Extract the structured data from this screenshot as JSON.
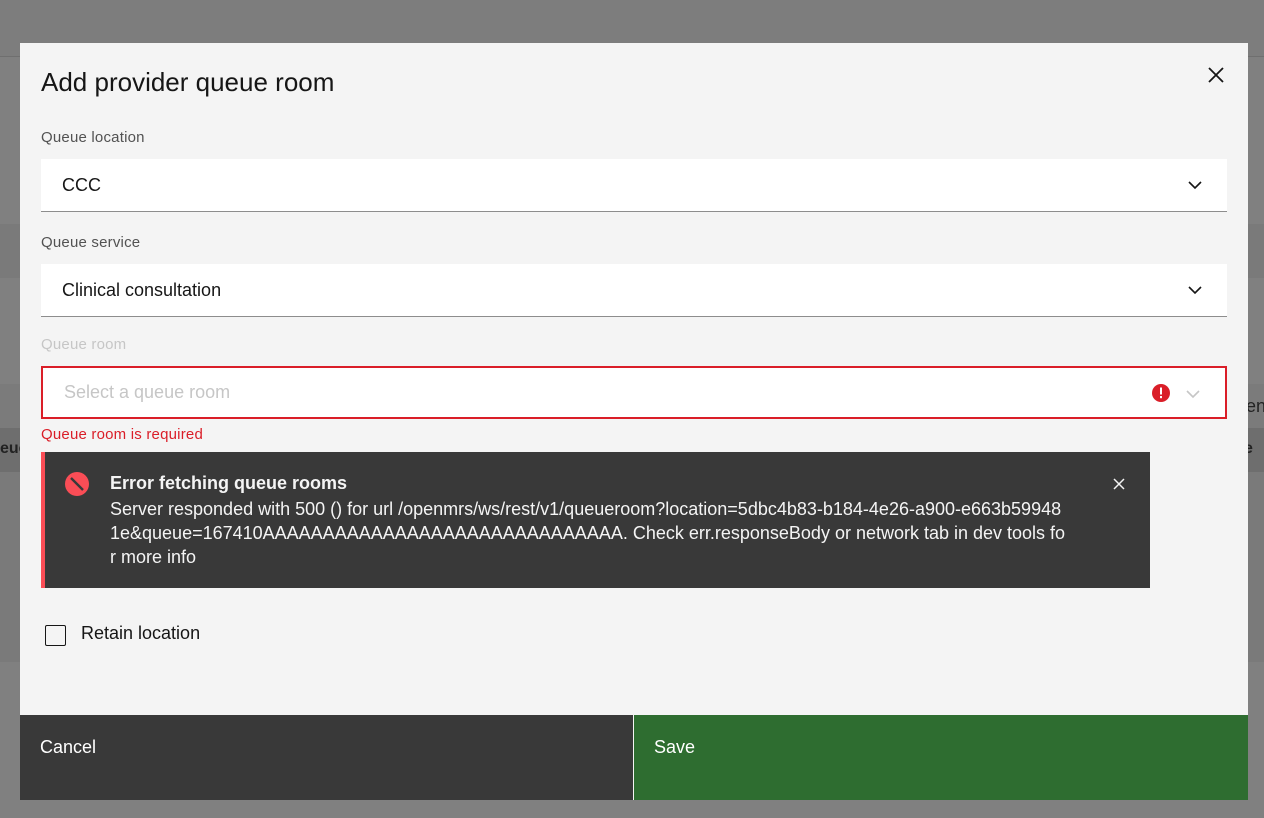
{
  "background": {
    "left_fragment": "eue",
    "right_fragment_1": "en",
    "right_fragment_2": "e"
  },
  "modal": {
    "title": "Add provider queue room",
    "close_icon": "close-icon",
    "queue_location": {
      "label": "Queue location",
      "value": "CCC"
    },
    "queue_service": {
      "label": "Queue service",
      "value": "Clinical consultation"
    },
    "queue_room": {
      "label": "Queue room",
      "placeholder": "Select a queue room",
      "error": "Queue room is required"
    },
    "notification": {
      "kind": "error",
      "title": "Error fetching queue rooms",
      "body": "Server responded with 500 () for url /openmrs/ws/rest/v1/queueroom?location=5dbc4b83-b184-4e26-a900-e663b599481e&queue=167410AAAAAAAAAAAAAAAAAAAAAAAAAAAAAA. Check err.responseBody or network tab in dev tools for more info"
    },
    "retain_location": {
      "label": "Retain location",
      "checked": false
    },
    "footer": {
      "cancel_label": "Cancel",
      "save_label": "Save"
    }
  },
  "colors": {
    "error_red": "#da1e28",
    "save_green": "#2e6d30",
    "notification_bg": "#393939"
  }
}
